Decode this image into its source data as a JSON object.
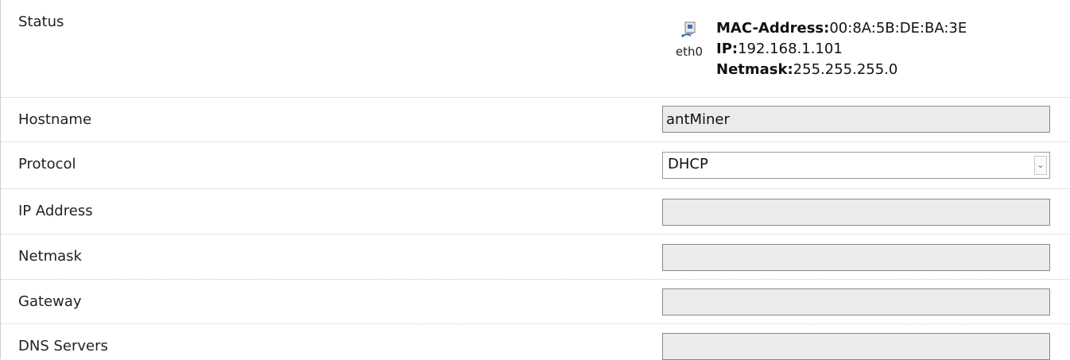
{
  "status": {
    "label": "Status",
    "interface": {
      "icon": "network-interface-icon",
      "name": "eth0",
      "mac_label": "MAC-Address:",
      "mac_value": "00:8A:5B:DE:BA:3E",
      "ip_label": "IP:",
      "ip_value": "192.168.1.101",
      "netmask_label": "Netmask:",
      "netmask_value": "255.255.255.0"
    }
  },
  "hostname": {
    "label": "Hostname",
    "value": "antMiner"
  },
  "protocol": {
    "label": "Protocol",
    "selected": "DHCP",
    "arrow_icon": "chevron-down-icon"
  },
  "ip_address": {
    "label": "IP Address",
    "value": ""
  },
  "netmask": {
    "label": "Netmask",
    "value": ""
  },
  "gateway": {
    "label": "Gateway",
    "value": ""
  },
  "dns_servers": {
    "label": "DNS Servers",
    "value": ""
  }
}
